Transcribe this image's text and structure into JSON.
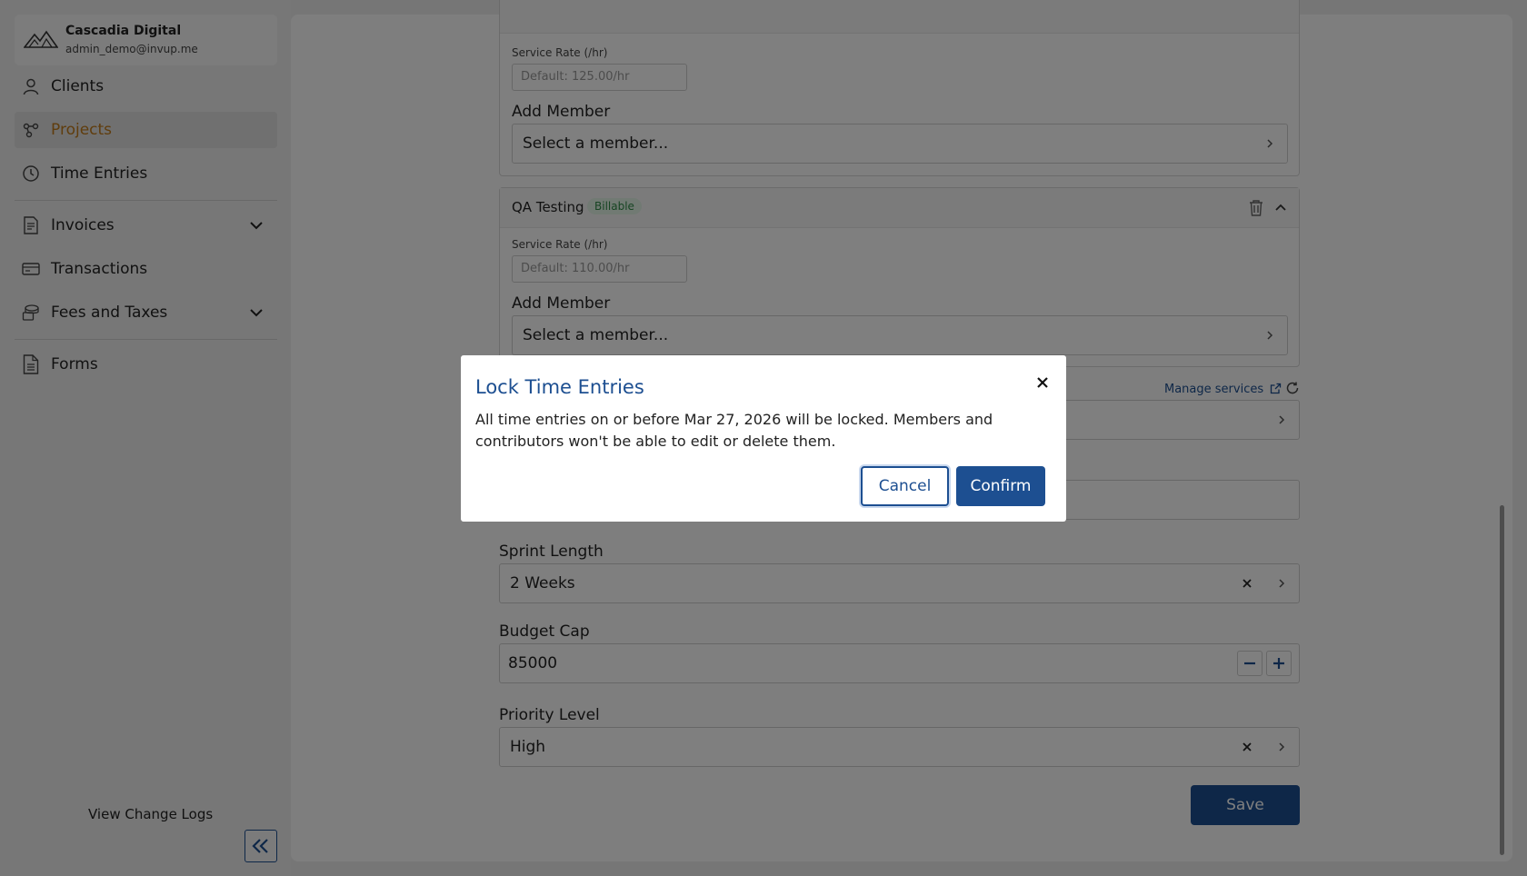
{
  "org": {
    "name": "Cascadia Digital",
    "email": "admin_demo@invup.me"
  },
  "sidebar": {
    "items": [
      {
        "label": "Clients",
        "icon": "user-icon"
      },
      {
        "label": "Projects",
        "icon": "projects-icon",
        "active": true
      },
      {
        "label": "Time Entries",
        "icon": "clock-icon"
      },
      {
        "label": "Invoices",
        "icon": "invoice-icon",
        "expandable": true
      },
      {
        "label": "Transactions",
        "icon": "card-icon"
      },
      {
        "label": "Fees and Taxes",
        "icon": "coins-icon",
        "expandable": true
      },
      {
        "label": "Forms",
        "icon": "document-icon"
      }
    ],
    "change_logs": "View Change Logs"
  },
  "services": [
    {
      "name": "",
      "rate_label": "Service Rate (/hr)",
      "rate_placeholder": "Default: 125.00/hr",
      "add_member_label": "Add Member",
      "member_placeholder": "Select a member..."
    },
    {
      "name": "QA Testing",
      "badge": "Billable",
      "rate_label": "Service Rate (/hr)",
      "rate_placeholder": "Default: 110.00/hr",
      "add_member_label": "Add Member",
      "member_placeholder": "Select a member..."
    }
  ],
  "manage_services": "Manage services",
  "fields": {
    "sprint_length": {
      "label": "Sprint Length",
      "value": "2 Weeks"
    },
    "budget_cap": {
      "label": "Budget Cap",
      "value": "85000"
    },
    "priority_level": {
      "label": "Priority Level",
      "value": "High"
    }
  },
  "save_label": "Save",
  "modal": {
    "title": "Lock Time Entries",
    "body": "All time entries on or before Mar 27, 2026 will be locked. Members and contributors won't be able to edit or delete them.",
    "cancel": "Cancel",
    "confirm": "Confirm"
  },
  "colors": {
    "primary": "#1d4f91",
    "active_nav": "#c07a1a",
    "badge_bg": "#e2f4e6",
    "badge_text": "#2f8a47"
  }
}
